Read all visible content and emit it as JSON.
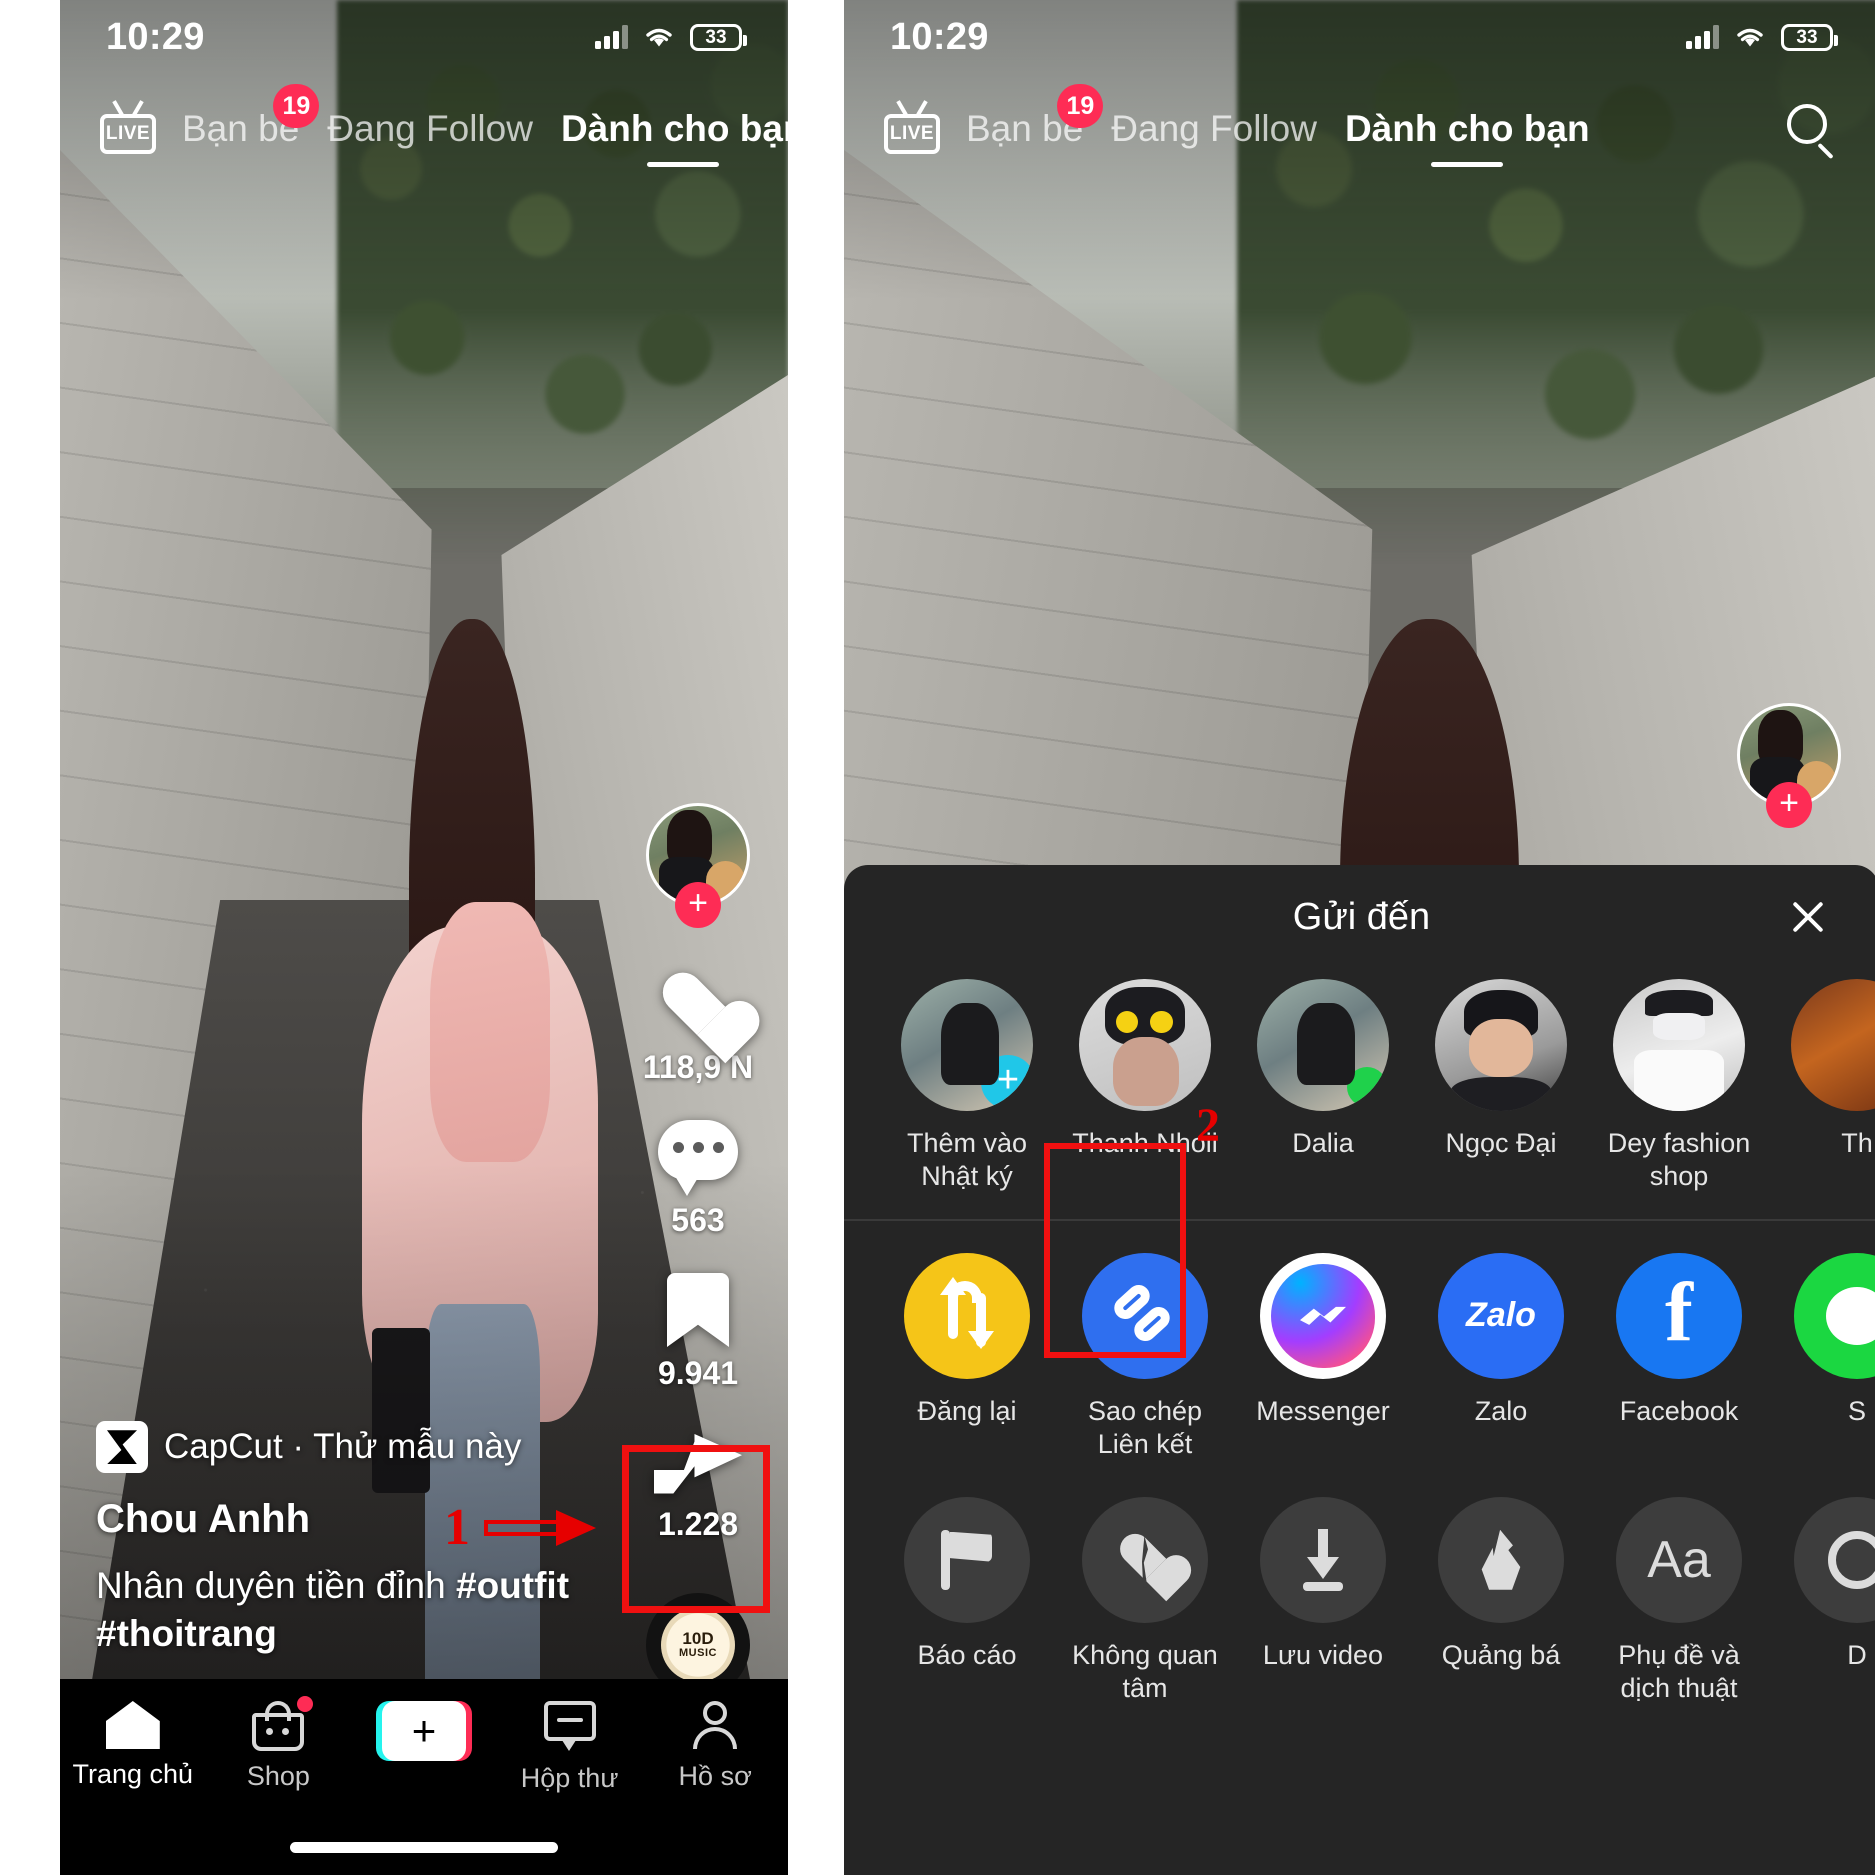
{
  "status_bar": {
    "time": "10:29",
    "battery": "33"
  },
  "top_nav": {
    "live_label": "LIVE",
    "tabs": [
      {
        "label": "Bạn bè",
        "badge": "19",
        "active": false
      },
      {
        "label": "Đang Follow",
        "badge": "",
        "active": false
      },
      {
        "label": "Dành cho bạn",
        "badge": "",
        "active": true
      }
    ],
    "search_icon": "search-icon"
  },
  "video": {
    "author": "Chou Anhh",
    "capcut_label": "CapCut · Thử mẫu này",
    "description_line1": "Nhân duyên tiền đỉnh ",
    "hashtag1": "#outfit",
    "hashtag2": "#thoitrang",
    "music_disc": "10D",
    "music_disc_sub": "MUSIC"
  },
  "rail": {
    "like_count": "118,9 N",
    "comment_count": "563",
    "bookmark_count": "9.941",
    "share_count": "1.228"
  },
  "tab_bar": {
    "items": [
      {
        "label": "Trang chủ",
        "icon": "home-icon",
        "active": true
      },
      {
        "label": "Shop",
        "icon": "shop-bag-icon",
        "active": false
      },
      {
        "label": "",
        "icon": "create-plus-icon",
        "active": false
      },
      {
        "label": "Hộp thư",
        "icon": "inbox-icon",
        "active": false
      },
      {
        "label": "Hồ sơ",
        "icon": "profile-person-icon",
        "active": false
      }
    ]
  },
  "share_sheet": {
    "title": "Gửi đến",
    "close_icon": "close-icon",
    "contacts": [
      {
        "label": "Thêm vào Nhật ký",
        "badge": "plus"
      },
      {
        "label": "Thanh Nhoii",
        "badge": ""
      },
      {
        "label": "Dalia",
        "badge": "online"
      },
      {
        "label": "Ngọc Đại",
        "badge": ""
      },
      {
        "label": "Dey fashion shop",
        "badge": ""
      },
      {
        "label": "Th",
        "badge": ""
      }
    ],
    "apps": [
      {
        "label": "Đăng lại",
        "icon": "repost-icon"
      },
      {
        "label": "Sao chép Liên kết",
        "icon": "link-icon"
      },
      {
        "label": "Messenger",
        "icon": "messenger-icon"
      },
      {
        "label": "Zalo",
        "icon": "zalo-icon"
      },
      {
        "label": "Facebook",
        "icon": "facebook-icon"
      },
      {
        "label": "S",
        "icon": "green-chat-icon"
      }
    ],
    "actions": [
      {
        "label": "Báo cáo",
        "icon": "flag-icon"
      },
      {
        "label": "Không quan tâm",
        "icon": "broken-heart-icon"
      },
      {
        "label": "Lưu video",
        "icon": "download-icon"
      },
      {
        "label": "Quảng bá",
        "icon": "fire-icon"
      },
      {
        "label": "Phụ đề và dịch thuật",
        "icon": "aa-text-icon"
      },
      {
        "label": "D",
        "icon": "circle-icon"
      }
    ]
  },
  "annotations": {
    "step1": "1",
    "step2": "2",
    "highlight_color": "#f01010"
  },
  "zalo_text": "Zalo"
}
